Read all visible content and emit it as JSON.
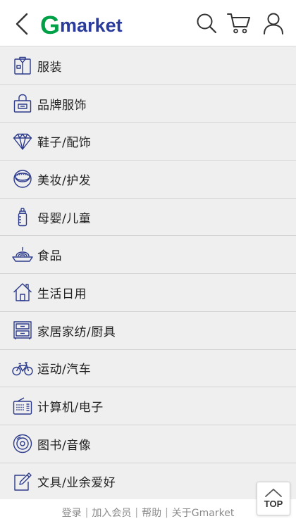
{
  "header": {
    "logo": {
      "g": "G",
      "rest": "market",
      "g_color": "#00a046",
      "text_color": "#2a3b9b"
    },
    "icons": [
      "back-icon",
      "search-icon",
      "cart-icon",
      "user-icon"
    ]
  },
  "menu": [
    {
      "label": "服装",
      "icon": "shirt-icon"
    },
    {
      "label": "品牌服饰",
      "icon": "bag-icon"
    },
    {
      "label": "鞋子/配饰",
      "icon": "diamond-icon"
    },
    {
      "label": "美妆/护发",
      "icon": "compact-icon"
    },
    {
      "label": "母婴/儿童",
      "icon": "baby-bottle-icon"
    },
    {
      "label": "食品",
      "icon": "food-bowl-icon"
    },
    {
      "label": "生活日用",
      "icon": "house-icon"
    },
    {
      "label": "家居家纺/厨具",
      "icon": "cabinet-icon"
    },
    {
      "label": "运动/汽车",
      "icon": "bicycle-icon"
    },
    {
      "label": "计算机/电子",
      "icon": "radio-icon"
    },
    {
      "label": "图书/音像",
      "icon": "disc-icon"
    },
    {
      "label": "文具/业余爱好",
      "icon": "pencil-icon"
    }
  ],
  "footer": {
    "login": "登录",
    "join": "加入会员",
    "help": "帮助",
    "about": "关于Gmarket"
  },
  "top_button": {
    "label": "TOP"
  },
  "colors": {
    "icon_stroke": "#2b3a8c",
    "row_bg": "#efefef",
    "divider": "#d3d3d3"
  }
}
